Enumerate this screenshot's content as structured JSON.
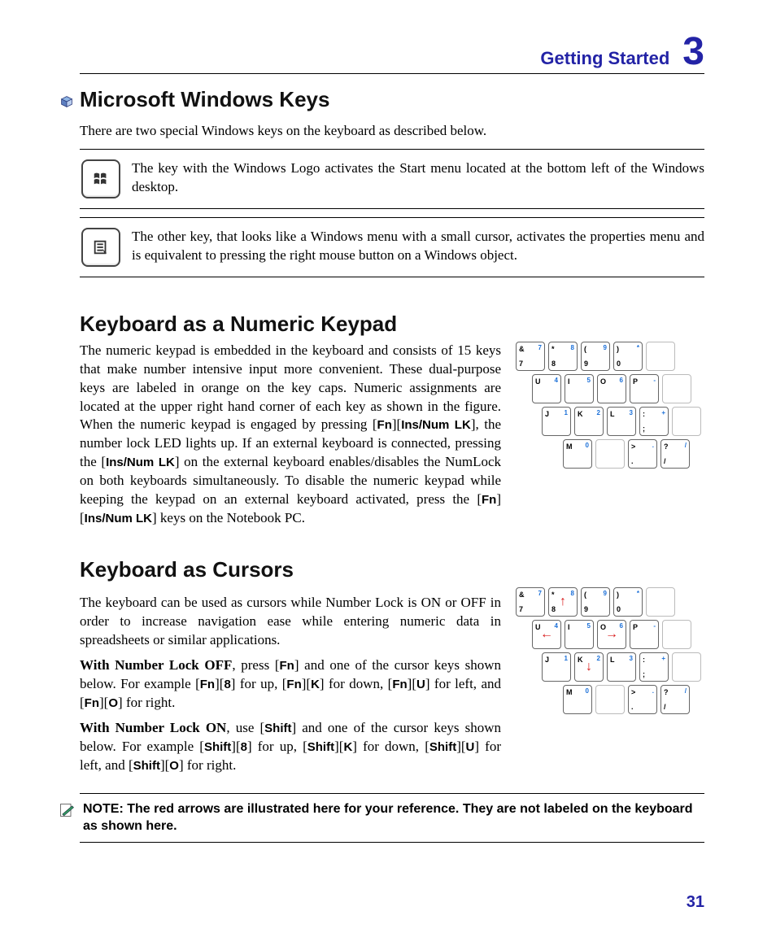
{
  "header": {
    "title": "Getting Started",
    "chapter": "3"
  },
  "sections": {
    "winkeys": {
      "heading": "Microsoft Windows Keys",
      "intro": "There are two special Windows keys on the keyboard as described below.",
      "row1": "The key with the Windows Logo activates the Start menu located at the bottom left of the Windows desktop.",
      "row2": "The other key, that looks like a Windows menu with a small cursor, activates the properties menu and is equivalent to pressing the right mouse button on a Windows object."
    },
    "numpad": {
      "heading": "Keyboard as a Numeric Keypad",
      "body_1": "The numeric keypad is embedded in the keyboard and consists of 15 keys that make number intensive input more convenient. These dual-purpose keys are labeled in orange on the key caps. Numeric assignments are located at the upper right hand corner of each key as shown in the figure. When the numeric keypad is engaged by pressing [",
      "k1": "Fn",
      "k1b": "][",
      "k2": "Ins/Num LK",
      "body_2": "], the number lock LED lights up. If an external keyboard is connected, pressing the [",
      "k3": "Ins/Num LK",
      "body_3": "] on the external keyboard enables/disables the NumLock on both keyboards simultaneously. To disable the numeric keypad while keeping the keypad on an external keyboard activated, press the  [",
      "k4": "Fn",
      "k4b": "][",
      "k5": "Ins/Num LK",
      "body_4": "] keys on the Notebook PC.",
      "keypad_rows": [
        [
          {
            "tl": "&",
            "bl": "7",
            "tr": "7"
          },
          {
            "tl": "*",
            "bl": "8",
            "tr": "8"
          },
          {
            "tl": "(",
            "bl": "9",
            "tr": "9"
          },
          {
            "tl": ")",
            "bl": "0",
            "tr": "*"
          },
          {
            "blank": true
          }
        ],
        [
          {
            "tl": "U",
            "tr": "4"
          },
          {
            "tl": "I",
            "tr": "5"
          },
          {
            "tl": "O",
            "tr": "6"
          },
          {
            "tl": "P",
            "tr": "-"
          },
          {
            "blank": true
          }
        ],
        [
          {
            "tl": "J",
            "tr": "1"
          },
          {
            "tl": "K",
            "tr": "2"
          },
          {
            "tl": "L",
            "tr": "3"
          },
          {
            "tl": ":",
            "bl": ";",
            "tr": "+"
          },
          {
            "blank": true
          }
        ],
        [
          {
            "tl": "M",
            "tr": "0"
          },
          {
            "blank": true
          },
          {
            "tl": ">",
            "bl": ".",
            "tr": "."
          },
          {
            "tl": "?",
            "bl": "/",
            "tr": "/"
          }
        ]
      ]
    },
    "cursors": {
      "heading": "Keyboard as Cursors",
      "para1": "The keyboard can be used as cursors while Number Lock is ON or OFF in order to increase navigation ease while entering numeric data in spreadsheets or similar applications.",
      "off_lead": "With Number Lock OFF",
      "off_rest": ", press [Fn] and one of the cursor keys shown below. For example [Fn][8] for up, [Fn][K] for down, [Fn][U] for left, and [Fn][O] for right.",
      "on_lead": "With Number Lock ON",
      "on_rest": ", use [Shift] and one of the cursor keys shown below. For example [Shift][8] for up, [Shift][K] for down, [Shift][U] for left, and [Shift][O] for right.",
      "keypad_rows": [
        [
          {
            "tl": "&",
            "bl": "7",
            "tr": "7"
          },
          {
            "tl": "*",
            "bl": "8",
            "tr": "8",
            "arrow": "↑"
          },
          {
            "tl": "(",
            "bl": "9",
            "tr": "9"
          },
          {
            "tl": ")",
            "bl": "0",
            "tr": "*"
          },
          {
            "blank": true
          }
        ],
        [
          {
            "tl": "U",
            "tr": "4",
            "arrow": "←"
          },
          {
            "tl": "I",
            "tr": "5"
          },
          {
            "tl": "O",
            "tr": "6",
            "arrow": "→"
          },
          {
            "tl": "P",
            "tr": "-"
          },
          {
            "blank": true
          }
        ],
        [
          {
            "tl": "J",
            "tr": "1"
          },
          {
            "tl": "K",
            "tr": "2",
            "arrow": "↓"
          },
          {
            "tl": "L",
            "tr": "3"
          },
          {
            "tl": ":",
            "bl": ";",
            "tr": "+"
          },
          {
            "blank": true
          }
        ],
        [
          {
            "tl": "M",
            "tr": "0"
          },
          {
            "blank": true
          },
          {
            "tl": ">",
            "bl": ".",
            "tr": "."
          },
          {
            "tl": "?",
            "bl": "/",
            "tr": "/"
          }
        ]
      ]
    }
  },
  "note": "NOTE: The red arrows are illustrated here for your reference. They are not labeled on the keyboard as shown here.",
  "page_number": "31"
}
